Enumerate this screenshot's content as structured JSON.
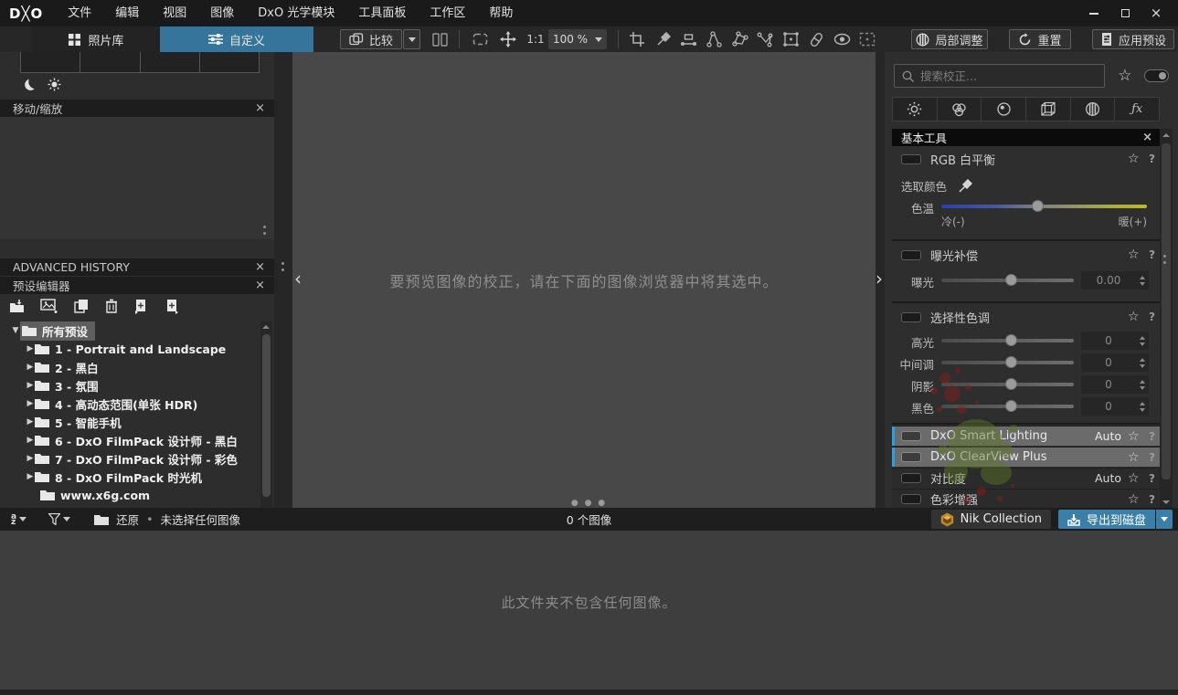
{
  "titlebar": {
    "logo": "D╳O",
    "menu": [
      "文件",
      "编辑",
      "视图",
      "图像",
      "DxO 光学模块",
      "工具面板",
      "工作区",
      "帮助"
    ]
  },
  "toolbar": {
    "tab_library": "照片库",
    "tab_customize": "自定义",
    "compare": "比较",
    "ratio": "1:1",
    "zoom": "100 %",
    "local_adjust": "局部调整",
    "reset": "重置",
    "apply_preset": "应用预设"
  },
  "left": {
    "move_zoom": "移动/缩放",
    "advanced_history": "ADVANCED HISTORY",
    "preset_editor": "预设编辑器",
    "preset_root": "所有预设",
    "presets": [
      "1 - Portrait and Landscape",
      "2 - 黑白",
      "3 - 氛围",
      "4 - 高动态范围(单张 HDR)",
      "5 - 智能手机",
      "6 - DxO FilmPack 设计师 - 黑白",
      "7 - DxO FilmPack 设计师 - 彩色",
      "8 - DxO FilmPack 时光机",
      "www.x6g.com"
    ]
  },
  "canvas": {
    "message": "要预览图像的校正，请在下面的图像浏览器中将其选中。"
  },
  "right": {
    "search_placeholder": "搜索校正...",
    "section_title": "基本工具",
    "wb_title": "RGB 白平衡",
    "pick_color": "选取颜色",
    "temperature": "色温",
    "cold": "冷(-)",
    "warm": "暖(+)",
    "exposure_title": "曝光补偿",
    "exposure_label": "曝光",
    "exposure_value": "0.00",
    "tone_title": "选择性色调",
    "tone_rows": [
      {
        "label": "高光",
        "value": "0"
      },
      {
        "label": "中间调",
        "value": "0"
      },
      {
        "label": "阴影",
        "value": "0"
      },
      {
        "label": "黑色",
        "value": "0"
      }
    ],
    "tools": [
      {
        "label": "DxO Smart Lighting",
        "auto": "Auto"
      },
      {
        "label": "DxO ClearView Plus",
        "auto": ""
      },
      {
        "label": "对比度",
        "auto": "Auto"
      },
      {
        "label": "色彩增强",
        "auto": ""
      }
    ]
  },
  "filmstrip": {
    "restore": "还原",
    "dot": "•",
    "status": "未选择任何图像",
    "count": "0 个图像",
    "nik": "Nik Collection",
    "export": "导出到磁盘"
  },
  "browser": {
    "empty": "此文件夹不包含任何图像。"
  },
  "colors": {
    "accent_blue": "#36759b",
    "export_blue": "#3b7fa8",
    "highlight_stripe": "#2aa0e0",
    "temp_gradient_left": "#2b3fae",
    "temp_gradient_right": "#b9bb27"
  }
}
